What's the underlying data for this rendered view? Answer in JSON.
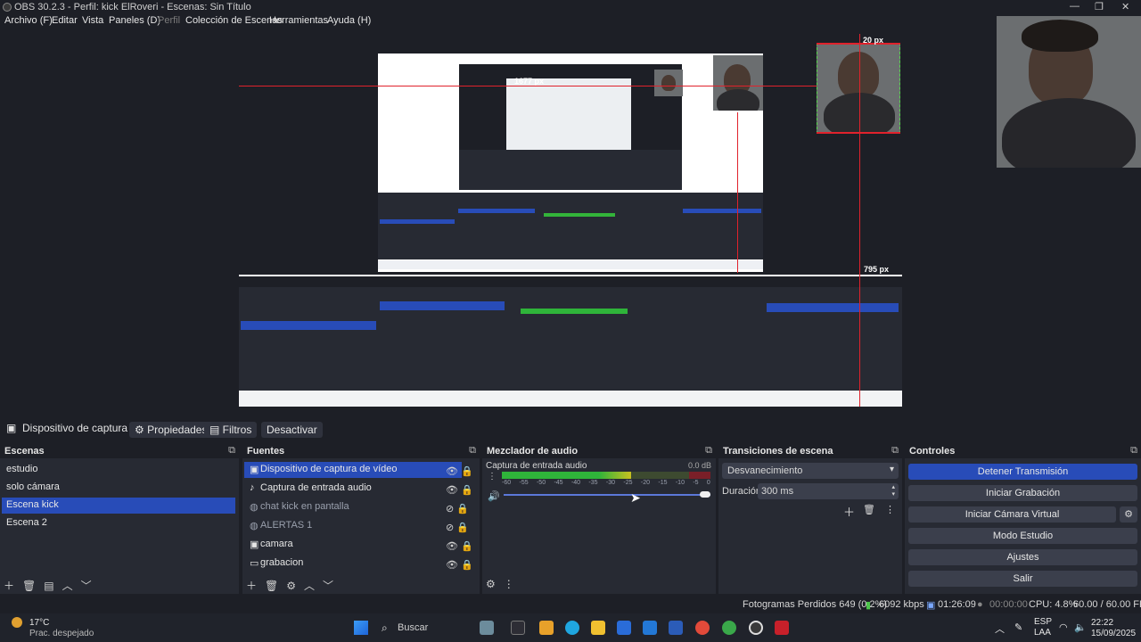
{
  "window": {
    "title": "OBS 30.2.3 - Perfil: kick ElRoveri - Escenas: Sin Título",
    "controls": [
      "—",
      "❐",
      "✕"
    ]
  },
  "menu": {
    "items": [
      "Archivo (F)",
      "Editar",
      "Vista",
      "Paneles (D)",
      "Perfil",
      "Colección de Escenas",
      "Herramientas",
      "Ayuda (H)"
    ]
  },
  "preview": {
    "measure_top": "1677 px",
    "measure_right": "795 px",
    "measure_small": "20 px"
  },
  "source_bar": {
    "source_name": "Dispositivo de captura de v",
    "properties": "Propiedades",
    "filters": "Filtros",
    "deactivate": "Desactivar"
  },
  "scenes": {
    "title": "Escenas",
    "items": [
      "estudio",
      "solo cámara",
      "Escena kick",
      "Escena 2"
    ],
    "selected_index": 2
  },
  "sources": {
    "title": "Fuentes",
    "items": [
      {
        "label": "Dispositivo de captura de vídeo",
        "icon": "camera-icon",
        "visible": true
      },
      {
        "label": "Captura de entrada audio",
        "icon": "microphone-icon",
        "visible": true
      },
      {
        "label": "chat kick en pantalla",
        "icon": "globe-icon",
        "visible": false
      },
      {
        "label": "ALERTAS 1",
        "icon": "globe-icon",
        "visible": false
      },
      {
        "label": "camara",
        "icon": "camera-icon",
        "visible": true
      },
      {
        "label": "grabacion",
        "icon": "monitor-icon",
        "visible": true
      }
    ]
  },
  "mixer": {
    "title": "Mezclador de audio",
    "channel": "Captura de entrada audio",
    "db": "0.0 dB",
    "ticks": [
      "-60",
      "-55",
      "-50",
      "-45",
      "-40",
      "-35",
      "-30",
      "-25",
      "-20",
      "-15",
      "-10",
      "-5",
      "0"
    ],
    "level": 0.62
  },
  "transitions": {
    "title": "Transiciones de escena",
    "selected": "Desvanecimiento",
    "duration_label": "Duración",
    "duration_value": "300 ms"
  },
  "controls": {
    "title": "Controles",
    "buttons": [
      "Detener Transmisión",
      "Iniciar Grabación",
      "Iniciar Cámara Virtual",
      "Modo Estudio",
      "Ajustes",
      "Salir"
    ]
  },
  "status": {
    "dropped": "Fotogramas Perdidos 649 (0.2%)",
    "bitrate": "6092 kbps",
    "stream_time": "01:26:09",
    "rec_time": "00:00:00",
    "cpu": "CPU: 4.8%",
    "fps": "60.00 / 60.00 FPS"
  },
  "taskbar": {
    "weather_temp": "17°C",
    "weather_desc": "Prac. despejado",
    "search": "Buscar",
    "lang_top": "ESP",
    "lang_bottom": "LAA",
    "time": "22:22",
    "date": "15/09/2025"
  }
}
